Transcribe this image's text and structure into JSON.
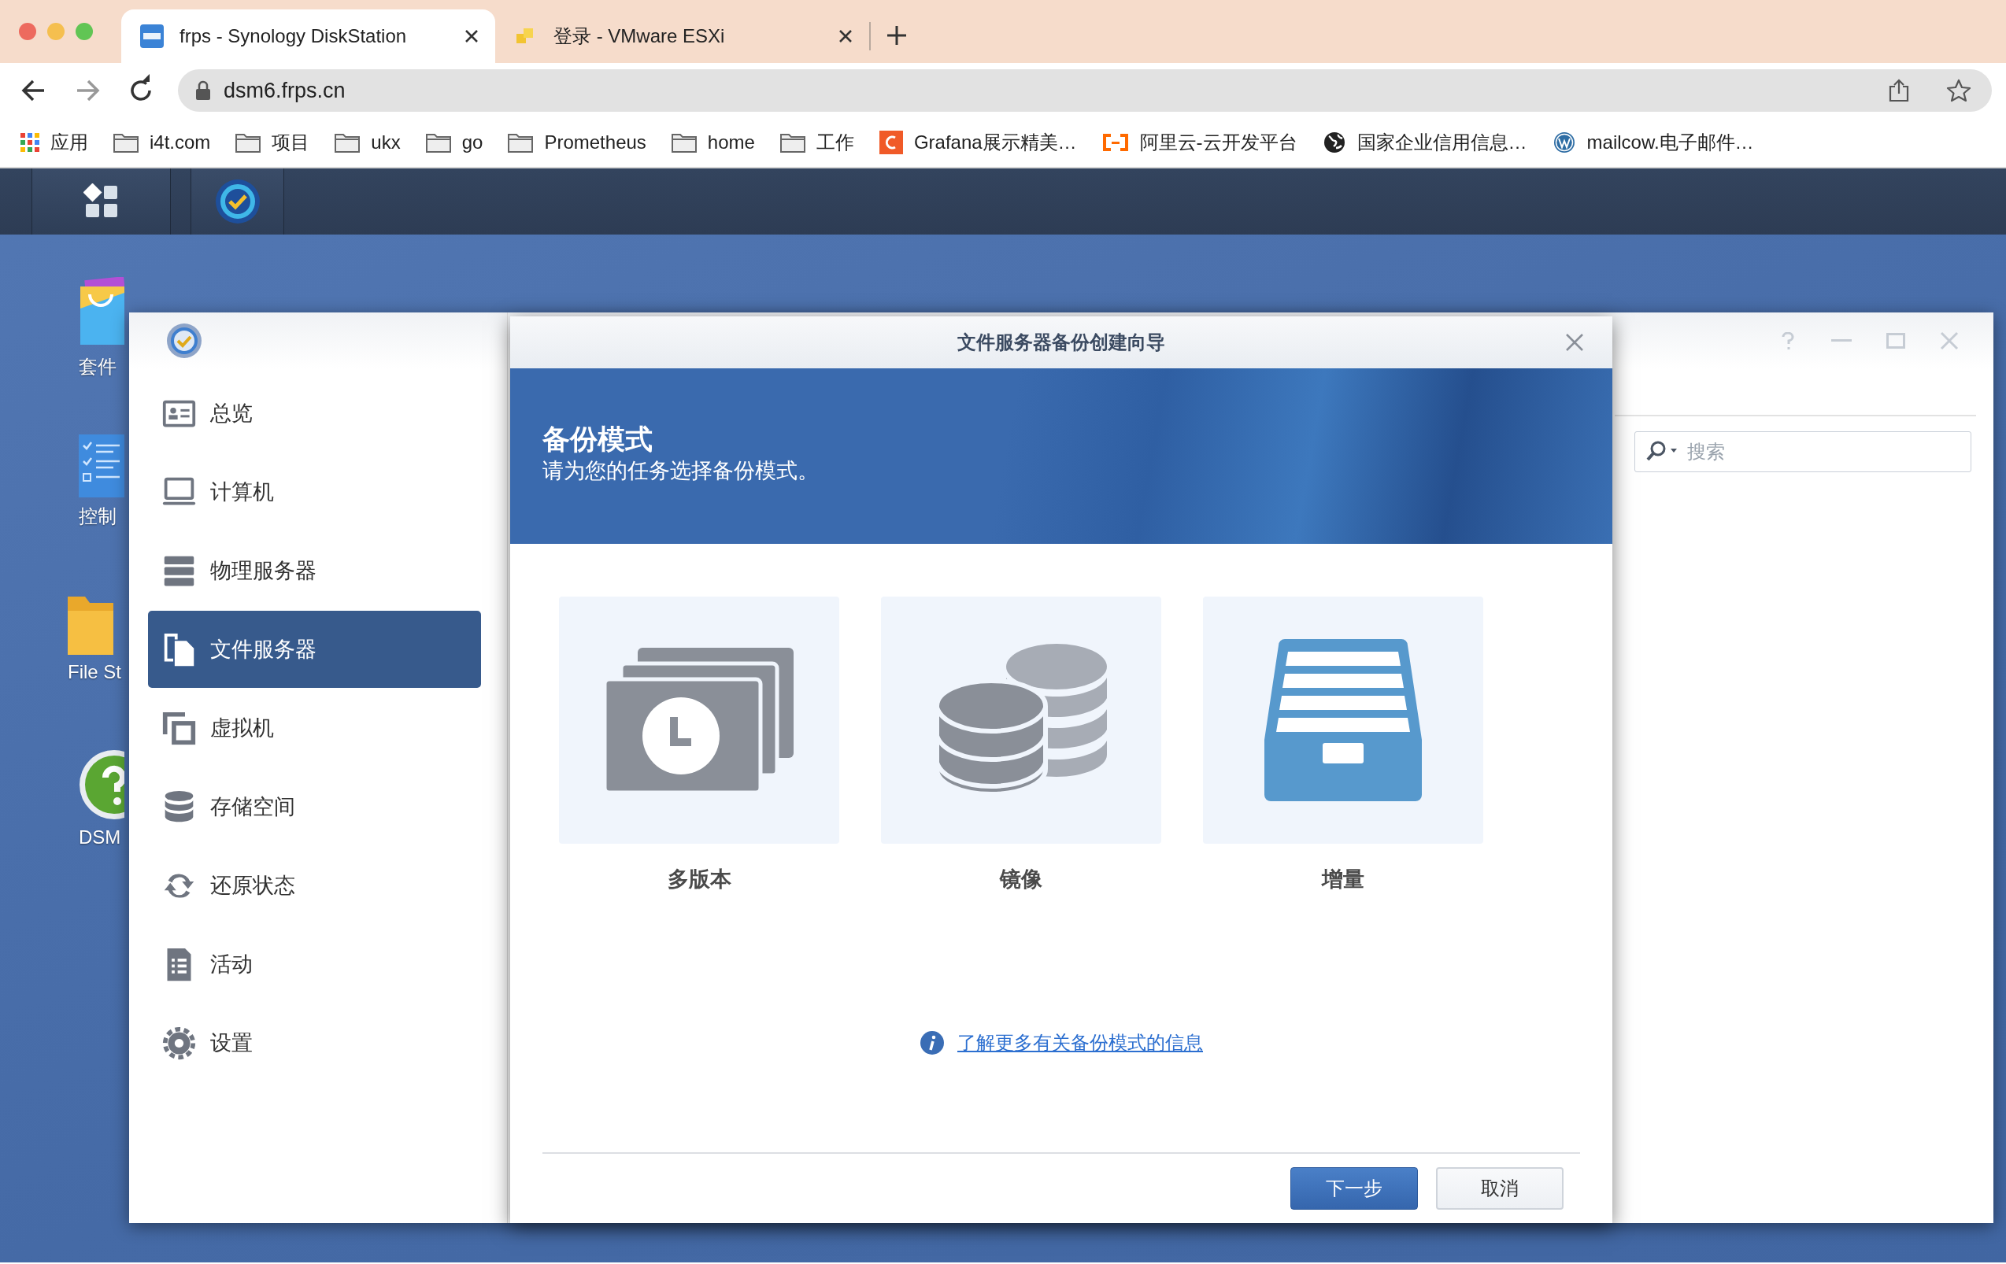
{
  "browser": {
    "tabs": [
      {
        "title": "frps - Synology DiskStation",
        "kind": "dsm",
        "selected": true
      },
      {
        "title": "登录 - VMware ESXi",
        "kind": "vmware",
        "selected": false
      }
    ],
    "address": "dsm6.frps.cn",
    "bookmarks": [
      {
        "label": "应用",
        "kind": "apps"
      },
      {
        "label": "i4t.com",
        "kind": "folder"
      },
      {
        "label": "项目",
        "kind": "folder"
      },
      {
        "label": "ukx",
        "kind": "folder"
      },
      {
        "label": "go",
        "kind": "folder"
      },
      {
        "label": "Prometheus",
        "kind": "folder"
      },
      {
        "label": "home",
        "kind": "folder"
      },
      {
        "label": "工作",
        "kind": "folder"
      },
      {
        "label": "Grafana展示精美…",
        "kind": "grafana"
      },
      {
        "label": "阿里云-云开发平台",
        "kind": "aliyun"
      },
      {
        "label": "国家企业信用信息…",
        "kind": "globe"
      },
      {
        "label": "mailcow.电子邮件…",
        "kind": "wordpress"
      }
    ]
  },
  "desktop": {
    "icons": [
      {
        "label": "套件",
        "kind": "package"
      },
      {
        "label": "控制",
        "kind": "control"
      },
      {
        "label": "File St",
        "kind": "folder"
      },
      {
        "label": "DSM",
        "kind": "help"
      }
    ]
  },
  "app": {
    "sidebar": [
      {
        "label": "总览",
        "kind": "overview",
        "selected": false
      },
      {
        "label": "计算机",
        "kind": "computer",
        "selected": false
      },
      {
        "label": "物理服务器",
        "kind": "server",
        "selected": false
      },
      {
        "label": "文件服务器",
        "kind": "fileserver",
        "selected": true
      },
      {
        "label": "虚拟机",
        "kind": "vm",
        "selected": false
      },
      {
        "label": "存储空间",
        "kind": "storage",
        "selected": false
      },
      {
        "label": "还原状态",
        "kind": "restore",
        "selected": false
      },
      {
        "label": "活动",
        "kind": "activity",
        "selected": false
      },
      {
        "label": "设置",
        "kind": "settings",
        "selected": false
      }
    ],
    "search": {
      "placeholder": "搜索"
    }
  },
  "wizard": {
    "title": "文件服务器备份创建向导",
    "heading": "备份模式",
    "subtitle": "请为您的任务选择备份模式。",
    "modes": [
      {
        "label": "多版本",
        "kind": "versions"
      },
      {
        "label": "镜像",
        "kind": "mirror"
      },
      {
        "label": "增量",
        "kind": "incremental"
      }
    ],
    "link": "了解更多有关备份模式的信息",
    "buttons": [
      {
        "label": "下一步",
        "kind": "primary"
      },
      {
        "label": "取消",
        "kind": "secondary"
      }
    ]
  }
}
